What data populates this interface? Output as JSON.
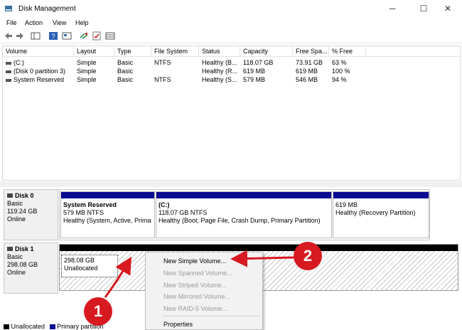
{
  "window": {
    "title": "Disk Management",
    "controls": {
      "minimize": "─",
      "maximize": "☐",
      "close": "✕"
    }
  },
  "menu": [
    "File",
    "Action",
    "View",
    "Help"
  ],
  "toolbar_icons": [
    "back-arrow-icon",
    "forward-arrow-icon",
    "console-tree-icon",
    "help-icon",
    "properties-icon",
    "connect-icon",
    "checklist-icon",
    "view-icon"
  ],
  "volume_list": {
    "columns": [
      "Volume",
      "Layout",
      "Type",
      "File System",
      "Status",
      "Capacity",
      "Free Spa...",
      "% Free"
    ],
    "rows": [
      [
        "(C:)",
        "Simple",
        "Basic",
        "NTFS",
        "Healthy (B...",
        "118.07 GB",
        "73.91 GB",
        "63 %"
      ],
      [
        "(Disk 0 partition 3)",
        "Simple",
        "Basic",
        "",
        "Healthy (R...",
        "619 MB",
        "619 MB",
        "100 %"
      ],
      [
        "System Reserved",
        "Simple",
        "Basic",
        "NTFS",
        "Healthy (S...",
        "579 MB",
        "546 MB",
        "94 %"
      ]
    ]
  },
  "disks": [
    {
      "name": "Disk 0",
      "type": "Basic",
      "size": "119.24 GB",
      "status": "Online",
      "partitions": [
        {
          "name": "System Reserved",
          "size": "579 MB NTFS",
          "status": "Healthy (System, Active, Prima"
        },
        {
          "name": "(C:)",
          "size": "118.07 GB NTFS",
          "status": "Healthy (Boot, Page File, Crash Dump, Primary Partition)"
        },
        {
          "name": "",
          "size": "619 MB",
          "status": "Healthy (Recovery Partition)"
        }
      ]
    },
    {
      "name": "Disk 1",
      "type": "Basic",
      "size": "298.08 GB",
      "status": "Online",
      "unallocated": {
        "size": "298.08 GB",
        "label": "Unallocated"
      }
    }
  ],
  "legend": [
    {
      "label": "Unallocated",
      "color": "#000000"
    },
    {
      "label": "Primary partition",
      "color": "#0a0a92"
    }
  ],
  "context_menu": {
    "items": [
      {
        "label": "New Simple Volume...",
        "enabled": true
      },
      {
        "label": "New Spanned Volume...",
        "enabled": false
      },
      {
        "label": "New Striped Volume...",
        "enabled": false
      },
      {
        "label": "New Mirrored Volume...",
        "enabled": false
      },
      {
        "label": "New RAID-5 Volume...",
        "enabled": false
      },
      {
        "label": "Properties",
        "enabled": true
      }
    ]
  },
  "callouts": [
    "1",
    "2"
  ],
  "colors": {
    "accent_red": "#d71920",
    "partition_bar": "#0a0a92"
  }
}
